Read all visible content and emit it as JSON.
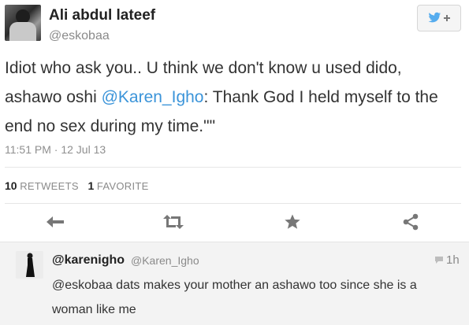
{
  "tweet": {
    "author_name": "Ali abdul lateef",
    "author_handle": "@eskobaa",
    "text_before": "Idiot who ask you.. U think we don't know u used dido, ashawo oshi ",
    "mention": "@Karen_Igho",
    "text_after": ": Thank God I held myself to the end no sex during my time.\"\"",
    "timestamp": "11:51 PM · 12 Jul 13",
    "retweets_count": "10",
    "retweets_label": "RETWEETS",
    "favorites_count": "1",
    "favorites_label": "FAVORITE",
    "follow_icon": "twitter-bird-follow-icon"
  },
  "actions": [
    {
      "name": "reply",
      "icon": "reply-arrow-icon"
    },
    {
      "name": "retweet",
      "icon": "retweet-icon"
    },
    {
      "name": "favorite",
      "icon": "star-icon"
    },
    {
      "name": "share",
      "icon": "share-icon"
    }
  ],
  "reply": {
    "author_name": "@karenigho",
    "author_handle": "@Karen_Igho",
    "time": "1h",
    "text": "@eskobaa dats makes your mother an ashawo too since she is a woman like me"
  },
  "colors": {
    "link": "#3b94d9",
    "twitter_blue": "#55acee",
    "icon_gray": "#777777"
  }
}
